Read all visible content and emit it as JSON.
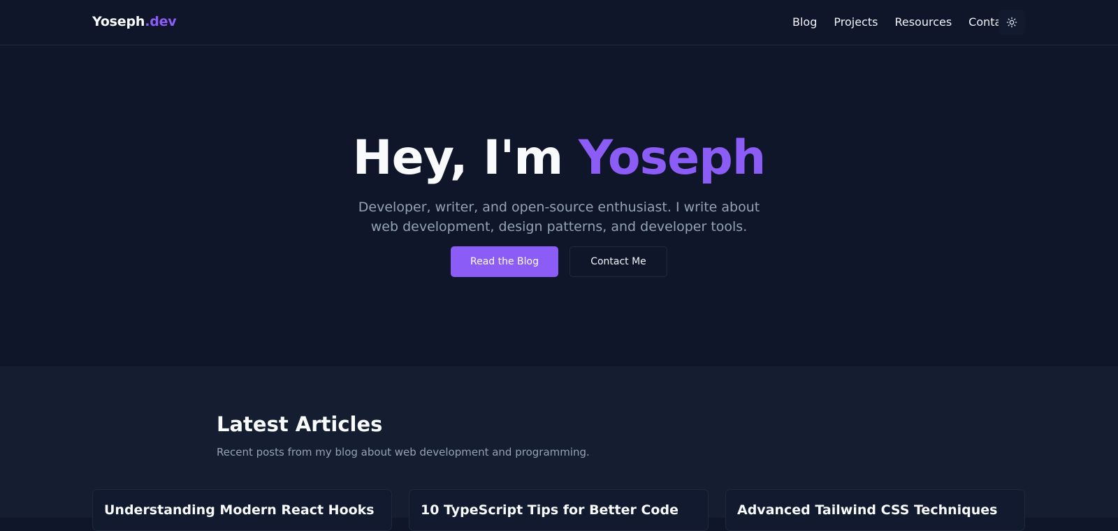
{
  "header": {
    "brand_name": "Yoseph",
    "brand_tld": ".dev",
    "nav": [
      "Blog",
      "Projects",
      "Resources",
      "Contact"
    ],
    "theme_toggle_icon": "sun-icon"
  },
  "hero": {
    "title_prefix": "Hey, I'm ",
    "title_name": "Yoseph",
    "subtitle": "Developer, writer, and open-source enthusiast. I write about web development, design patterns, and developer tools.",
    "primary_button": "Read the Blog",
    "secondary_button": "Contact Me"
  },
  "articles": {
    "heading": "Latest Articles",
    "subheading": "Recent posts from my blog about web development and programming.",
    "cards": [
      {
        "title": "Understanding Modern React Hooks"
      },
      {
        "title": "10 TypeScript Tips for Better Code"
      },
      {
        "title": "Advanced Tailwind CSS Techniques"
      }
    ]
  },
  "colors": {
    "background": "#0f1629",
    "section_background": "#151d30",
    "accent": "#8b5cf6",
    "muted_text": "#94a3b8",
    "border": "#1e293b"
  }
}
